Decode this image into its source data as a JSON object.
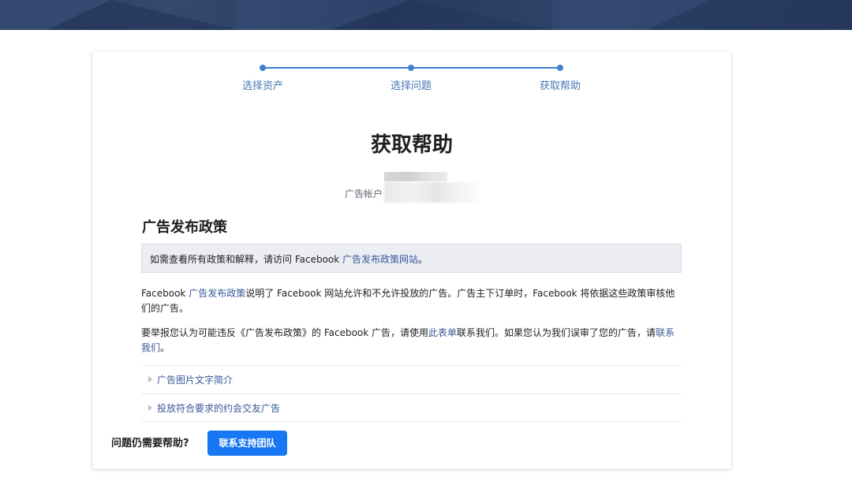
{
  "stepper": {
    "steps": [
      {
        "label": "选择资产"
      },
      {
        "label": "选择问题"
      },
      {
        "label": "获取帮助"
      }
    ]
  },
  "page_title": "获取帮助",
  "account": {
    "label": "广告帐户"
  },
  "policy": {
    "section_title": "广告发布政策",
    "notice": {
      "prefix": "如需查看所有政策和解释，请访问 Facebook ",
      "link": "广告发布政策网站",
      "suffix": "。"
    },
    "para1": {
      "prefix": "Facebook ",
      "link": "广告发布政策",
      "suffix": "说明了 Facebook 网站允许和不允许投放的广告。广告主下订单时，Facebook 将依据这些政策审核他们的广告。"
    },
    "para2": {
      "prefix": "要举报您认为可能违反《广告发布政策》的 Facebook 广告，请使用",
      "link1": "此表单",
      "middle": "联系我们。如果您认为我们误审了您的广告，请",
      "link2": "联系我们",
      "suffix": "。"
    },
    "accordion": [
      {
        "label": "广告图片文字简介"
      },
      {
        "label": "投放符合要求的约会交友广告"
      }
    ]
  },
  "footer": {
    "question": "问题仍需要帮助?",
    "button_label": "联系支持团队"
  },
  "colors": {
    "accent": "#1877f2",
    "link": "#385898",
    "step": "#4080d0",
    "banner": "#2c3e62"
  }
}
